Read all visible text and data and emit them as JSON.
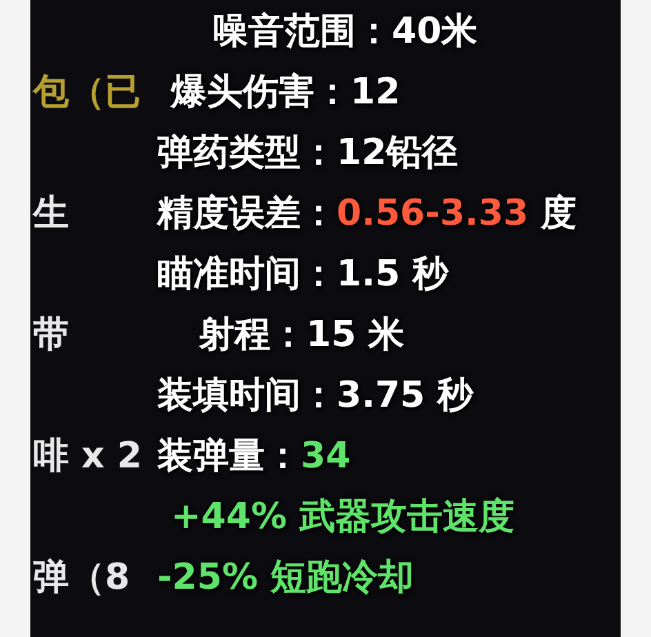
{
  "rows": [
    {
      "kind": "stat",
      "label": "噪音范围：",
      "value": "40米",
      "color": "#ffffff"
    },
    {
      "kind": "stat",
      "label": "爆头伤害：",
      "value": "12",
      "color": "#ffffff",
      "behind": {
        "text": "包（已",
        "color": "#b8a030"
      }
    },
    {
      "kind": "stat",
      "label": "弹药类型：",
      "value": "12铅径",
      "color": "#ffffff"
    },
    {
      "kind": "stat",
      "label": "精度误差：",
      "value": "0.56-3.33",
      "unit": "度",
      "color": "#ff5a3c",
      "behind": {
        "text": "生",
        "color": "#e8e8e8"
      }
    },
    {
      "kind": "stat",
      "label": "瞄准时间：",
      "value": "1.5 秒",
      "color": "#ffffff"
    },
    {
      "kind": "stat",
      "label": "射程：",
      "value": "15 米",
      "color": "#ffffff",
      "behind": {
        "text": "带",
        "color": "#e8e8e8"
      }
    },
    {
      "kind": "stat",
      "label": "装填时间：",
      "value": "3.75 秒",
      "color": "#ffffff"
    },
    {
      "kind": "stat",
      "label": "装弹量：",
      "value": "34",
      "color": "#5fe36a",
      "behind": {
        "text": "啡 x 2",
        "color": "#e8e8e8"
      }
    },
    {
      "kind": "bonus",
      "text": "+44% 武器攻击速度",
      "color": "#5fe36a"
    },
    {
      "kind": "bonus",
      "text": "-25% 短跑冷却",
      "color": "#5fe36a",
      "behind": {
        "text": "弹（8",
        "color": "#e8e8e8"
      }
    }
  ]
}
